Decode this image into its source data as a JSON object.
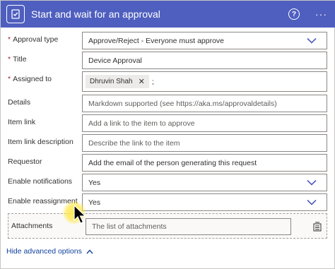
{
  "header": {
    "title": "Start and wait for an approval",
    "help_glyph": "?",
    "more_glyph": "···",
    "color": "#4f5fbf"
  },
  "fields": {
    "approval_type": {
      "label": "Approval type",
      "required": "*",
      "value": "Approve/Reject - Everyone must approve"
    },
    "title": {
      "label": "Title",
      "required": "*",
      "value": "Device Approval"
    },
    "assigned_to": {
      "label": "Assigned to",
      "required": "*",
      "tag": "Dhruvin Shah",
      "tag_remove": "✕",
      "separator": ";"
    },
    "details": {
      "label": "Details",
      "placeholder": "Markdown supported (see https://aka.ms/approvaldetails)"
    },
    "item_link": {
      "label": "Item link",
      "placeholder": "Add a link to the item to approve"
    },
    "item_link_description": {
      "label": "Item link description",
      "placeholder": "Describe the link to the item"
    },
    "requestor": {
      "label": "Requestor",
      "placeholder": "Add the email of the person generating this request"
    },
    "enable_notifications": {
      "label": "Enable notifications",
      "value": "Yes"
    },
    "enable_reassignment": {
      "label": "Enable reassignment",
      "value": "Yes"
    },
    "attachments": {
      "label": "Attachments",
      "placeholder": "The list of attachments"
    }
  },
  "advanced": {
    "label": "Hide advanced options"
  },
  "icons": {
    "app": "approval-check-icon",
    "help": "help-circle-icon",
    "more": "more-horizontal-icon",
    "dropdown": "chevron-down-icon",
    "attachment_action": "switch-to-array-icon",
    "advanced": "chevron-up-icon"
  },
  "colors": {
    "link": "#0f3f9e",
    "required": "#a4262c"
  }
}
